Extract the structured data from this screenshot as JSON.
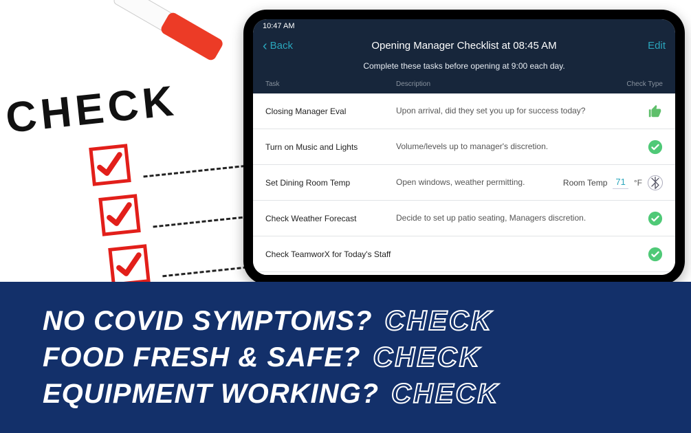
{
  "paper": {
    "word": "CHECK"
  },
  "tablet": {
    "status_time": "10:47 AM",
    "nav": {
      "back": "Back",
      "title": "Opening Manager Checklist at 08:45 AM",
      "edit": "Edit"
    },
    "subtitle": "Complete these tasks before opening at 9:00 each day.",
    "columns": {
      "task": "Task",
      "desc": "Description",
      "type": "Check Type"
    },
    "rows": [
      {
        "task": "Closing Manager Eval",
        "desc": "Upon arrival, did they set you up for success today?",
        "icon": "thumb"
      },
      {
        "task": "Turn on Music and Lights",
        "desc": "Volume/levels up to manager's discretion.",
        "icon": "check"
      },
      {
        "task": "Set Dining Room Temp",
        "desc": "Open windows, weather permitting.",
        "extra_label": "Room Temp",
        "temp_value": "71",
        "temp_unit": "°F",
        "icon": "bluetooth"
      },
      {
        "task": "Check Weather Forecast",
        "desc": "Decide to set up patio seating, Managers discretion.",
        "icon": "check"
      },
      {
        "task": "Check TeamworX for Today's Staff",
        "desc": "",
        "icon": "check"
      }
    ]
  },
  "banner": {
    "lines": [
      {
        "q": "NO COVID SYMPTOMS?",
        "a": "CHECK"
      },
      {
        "q": "FOOD FRESH & SAFE?",
        "a": "CHECK"
      },
      {
        "q": "EQUIPMENT WORKING?",
        "a": "CHECK"
      }
    ]
  }
}
